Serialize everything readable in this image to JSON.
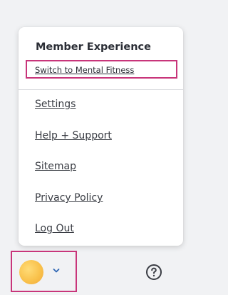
{
  "menu": {
    "section_title": "Member Experience",
    "switch_link": "Switch to Mental Fitness",
    "items": [
      "Settings",
      "Help + Support",
      "Sitemap",
      "Privacy Policy",
      "Log Out"
    ]
  },
  "account": {
    "avatar_icon": "user-avatar-icon",
    "dropdown_icon": "chevron-down-icon"
  },
  "help": {
    "icon": "help-circle-icon"
  },
  "colors": {
    "highlight": "#c8357a",
    "chevron": "#2f66b3",
    "avatar": "#f9c24c"
  }
}
